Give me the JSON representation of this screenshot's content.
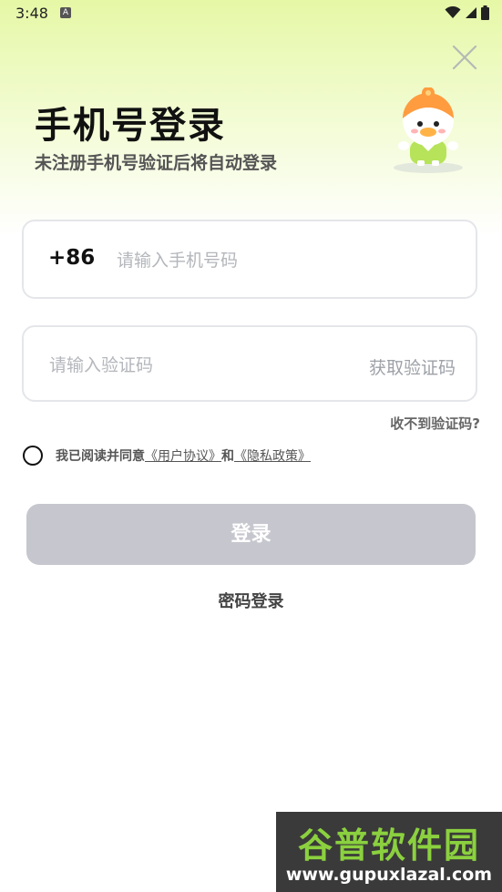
{
  "status_bar": {
    "time": "3:48",
    "app_icon": "A",
    "icons": [
      "wifi-icon",
      "signal-icon",
      "battery-icon"
    ]
  },
  "header": {
    "title": "手机号登录",
    "subtitle": "未注册手机号验证后将自动登录",
    "close_icon": "close-icon",
    "mascot": "duck-mascot-illustration"
  },
  "phone_field": {
    "country_code": "+86",
    "placeholder": "请输入手机号码",
    "value": ""
  },
  "code_field": {
    "placeholder": "请输入验证码",
    "value": "",
    "get_code_label": "获取验证码"
  },
  "no_code_link": "收不到验证码?",
  "agreement": {
    "checked": false,
    "prefix": "我已阅读并同意",
    "user_agreement": "《用户协议》",
    "and": "和",
    "privacy_policy": "《隐私政策》"
  },
  "login_button": "登录",
  "password_login": "密码登录",
  "watermark": {
    "title": "谷普软件园",
    "url": "www.gupuxlazal.com"
  },
  "colors": {
    "gradient_top": "#e6f8a6",
    "login_button_disabled": "#c6c7ce",
    "watermark_green": "#8bd13f"
  }
}
